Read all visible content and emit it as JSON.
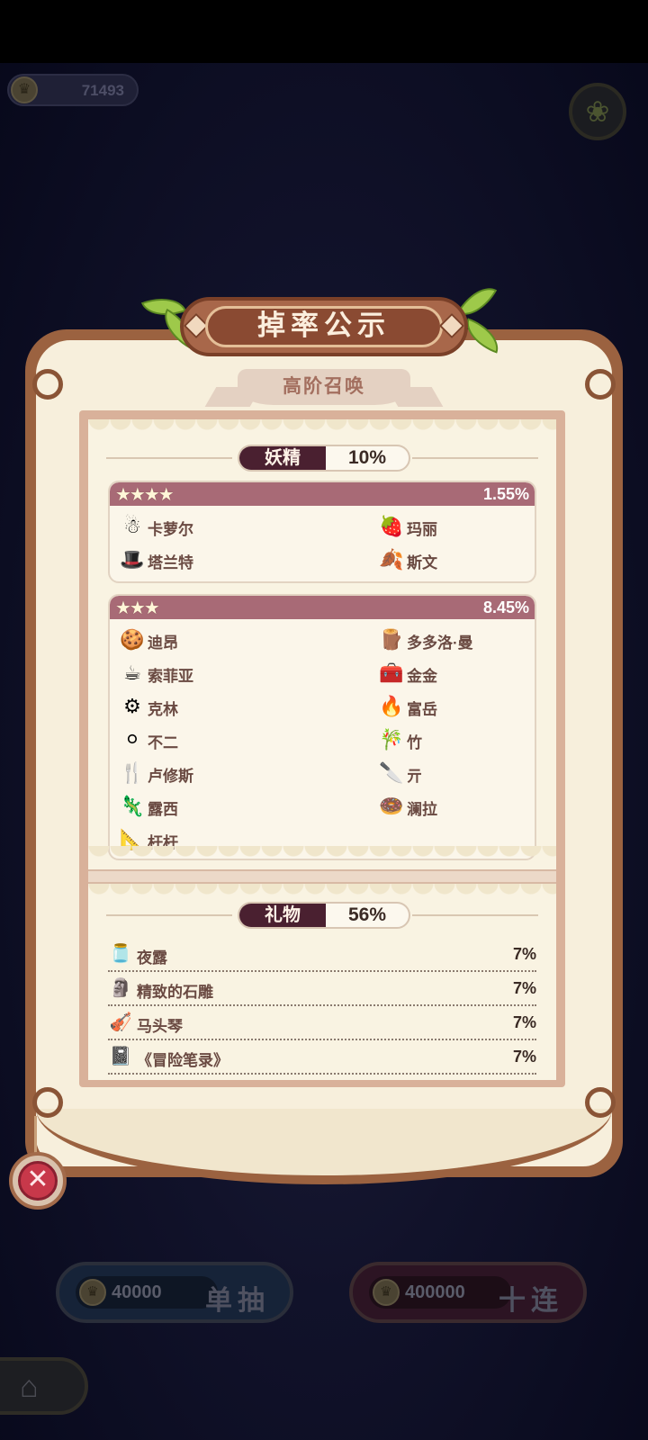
{
  "hud": {
    "coins": "71493",
    "help_icon": "sprout-icon"
  },
  "dialog": {
    "title": "掉率公示",
    "subtitle": "高阶召唤"
  },
  "fairy_section": {
    "name": "妖精",
    "rate": "10%",
    "tiers": [
      {
        "stars": "★★★★",
        "rate": "1.55%",
        "items": [
          {
            "name": "卡萝尔",
            "icon": "☃"
          },
          {
            "name": "玛丽",
            "icon": "🍓"
          },
          {
            "name": "塔兰特",
            "icon": "🎩"
          },
          {
            "name": "斯文",
            "icon": "🍂"
          }
        ]
      },
      {
        "stars": "★★★",
        "rate": "8.45%",
        "items": [
          {
            "name": "迪昂",
            "icon": "🍪"
          },
          {
            "name": "多多洛·曼",
            "icon": "🪵"
          },
          {
            "name": "索菲亚",
            "icon": "☕"
          },
          {
            "name": "金金",
            "icon": "🧰"
          },
          {
            "name": "克林",
            "icon": "⚙"
          },
          {
            "name": "富岳",
            "icon": "🔥"
          },
          {
            "name": "不二",
            "icon": "⚪"
          },
          {
            "name": "竹",
            "icon": "🎋"
          },
          {
            "name": "卢修斯",
            "icon": "🍴"
          },
          {
            "name": "亓",
            "icon": "🔪"
          },
          {
            "name": "露西",
            "icon": "🦎"
          },
          {
            "name": "澜拉",
            "icon": "🍩"
          },
          {
            "name": "杆杆",
            "icon": "📐"
          }
        ]
      }
    ]
  },
  "gift_section": {
    "name": "礼物",
    "rate": "56%",
    "items": [
      {
        "name": "夜露",
        "rate": "7%",
        "icon": "🫙"
      },
      {
        "name": "精致的石雕",
        "rate": "7%",
        "icon": "🗿"
      },
      {
        "name": "马头琴",
        "rate": "7%",
        "icon": "🎻"
      },
      {
        "name": "《冒险笔录》",
        "rate": "7%",
        "icon": "📓"
      }
    ]
  },
  "buttons": {
    "single_cost": "40000",
    "single_label": "单抽",
    "ten_cost": "400000",
    "ten_label": "十连",
    "close_glyph": "✕",
    "home_glyph": "⌂"
  },
  "colors": {
    "frame": "#9b6240",
    "parchment": "#f7efdc",
    "tier_bar": "#a86a76",
    "category_dark": "#4a2030",
    "close_red": "#c8384a"
  }
}
